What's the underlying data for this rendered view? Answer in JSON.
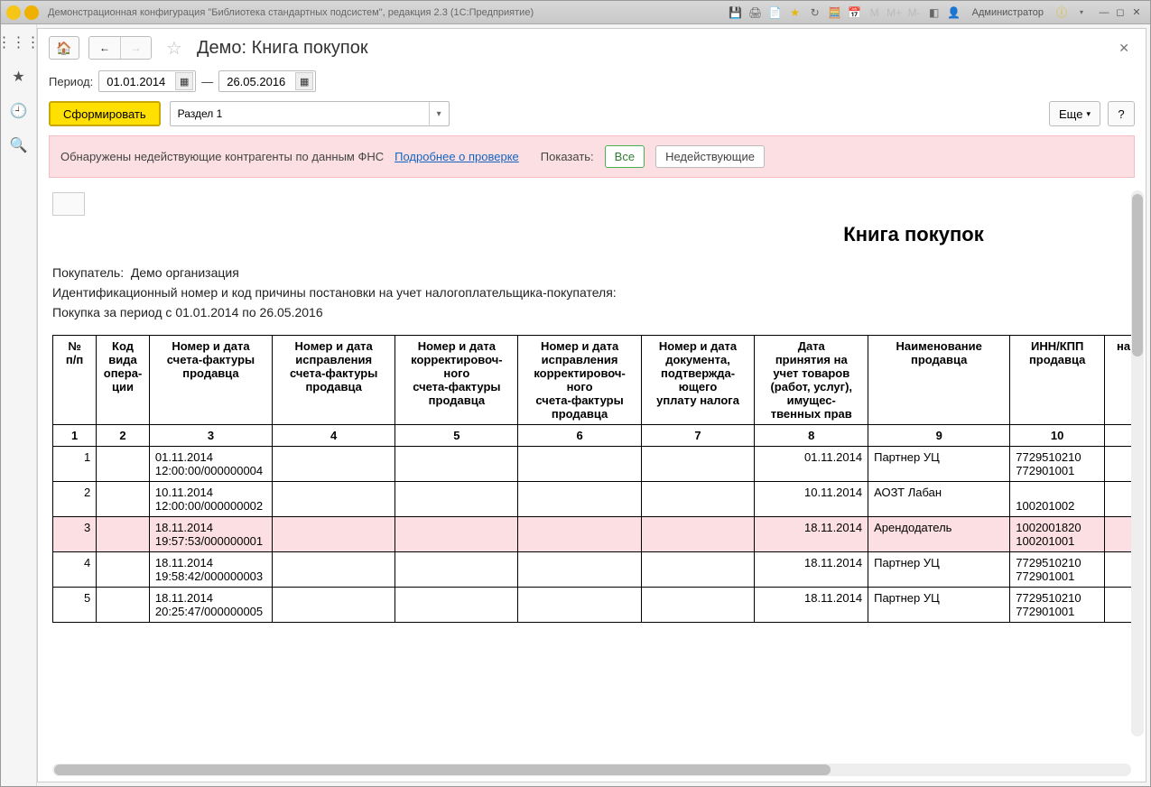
{
  "titlebar": {
    "text": "Демонстрационная конфигурация \"Библиотека стандартных подсистем\", редакция 2.3  (1С:Предприятие)",
    "user": "Администратор"
  },
  "page": {
    "title": "Демо: Книга покупок",
    "period_label": "Период:",
    "date_from": "01.01.2014",
    "dash": "—",
    "date_to": "26.05.2016",
    "generate_btn": "Сформировать",
    "section_selected": "Раздел 1",
    "more_btn": "Еще",
    "help_btn": "?"
  },
  "warning": {
    "text": "Обнаружены недействующие контрагенты по данным ФНС",
    "details_link": "Подробнее о проверке",
    "show_label": "Показать:",
    "all_btn": "Все",
    "invalid_btn": "Недействующие"
  },
  "report": {
    "title": "Книга покупок",
    "buyer_label": "Покупатель:",
    "buyer_value": "Демо организация",
    "id_line": "Идентификационный номер и код причины постановки на учет налогоплательщика-покупателя:",
    "period_line": "Покупка за период с 01.01.2014 по 26.05.2016",
    "headers": {
      "h1": "№\nп/п",
      "h2": "Код\nвида\nопера-\nции",
      "h3": "Номер и дата\nсчета-фактуры\nпродавца",
      "h4": "Номер и дата\nисправления\nсчета-фактуры\nпродавца",
      "h5": "Номер и дата\nкорректировоч-\nного\nсчета-фактуры\nпродавца",
      "h6": "Номер и дата\nисправления\nкорректировоч-\nного\nсчета-фактуры\nпродавца",
      "h7": "Номер и дата\nдокумента,\nподтвержда-\nющего\nуплату налога",
      "h8": "Дата\nпринятия на\nучет  товаров\n(работ, услуг),\nимущес-\nтвенных прав",
      "h9": "Наименование\nпродавца",
      "h10": "ИНН/КПП\nпродавца",
      "h11": "на"
    },
    "colnums": [
      "1",
      "2",
      "3",
      "4",
      "5",
      "6",
      "7",
      "8",
      "9",
      "10",
      ""
    ],
    "rows": [
      {
        "n": "1",
        "op": "",
        "sf": "01.11.2014 12:00:00/000000004",
        "c4": "",
        "c5": "",
        "c6": "",
        "c7": "",
        "date": "01.11.2014",
        "seller": "Партнер УЦ",
        "inn": "7729510210 772901001",
        "invalid": false
      },
      {
        "n": "2",
        "op": "",
        "sf": "10.11.2014 12:00:00/000000002",
        "c4": "",
        "c5": "",
        "c6": "",
        "c7": "",
        "date": "10.11.2014",
        "seller": "АОЗТ Лабан",
        "inn": "\n100201002",
        "invalid": false
      },
      {
        "n": "3",
        "op": "",
        "sf": "18.11.2014 19:57:53/000000001",
        "c4": "",
        "c5": "",
        "c6": "",
        "c7": "",
        "date": "18.11.2014",
        "seller": "Арендодатель",
        "inn": "1002001820 100201001",
        "invalid": true
      },
      {
        "n": "4",
        "op": "",
        "sf": "18.11.2014 19:58:42/000000003",
        "c4": "",
        "c5": "",
        "c6": "",
        "c7": "",
        "date": "18.11.2014",
        "seller": "Партнер УЦ",
        "inn": "7729510210 772901001",
        "invalid": false
      },
      {
        "n": "5",
        "op": "",
        "sf": "18.11.2014 20:25:47/000000005",
        "c4": "",
        "c5": "",
        "c6": "",
        "c7": "",
        "date": "18.11.2014",
        "seller": "Партнер УЦ",
        "inn": "7729510210 772901001",
        "invalid": false
      }
    ]
  }
}
